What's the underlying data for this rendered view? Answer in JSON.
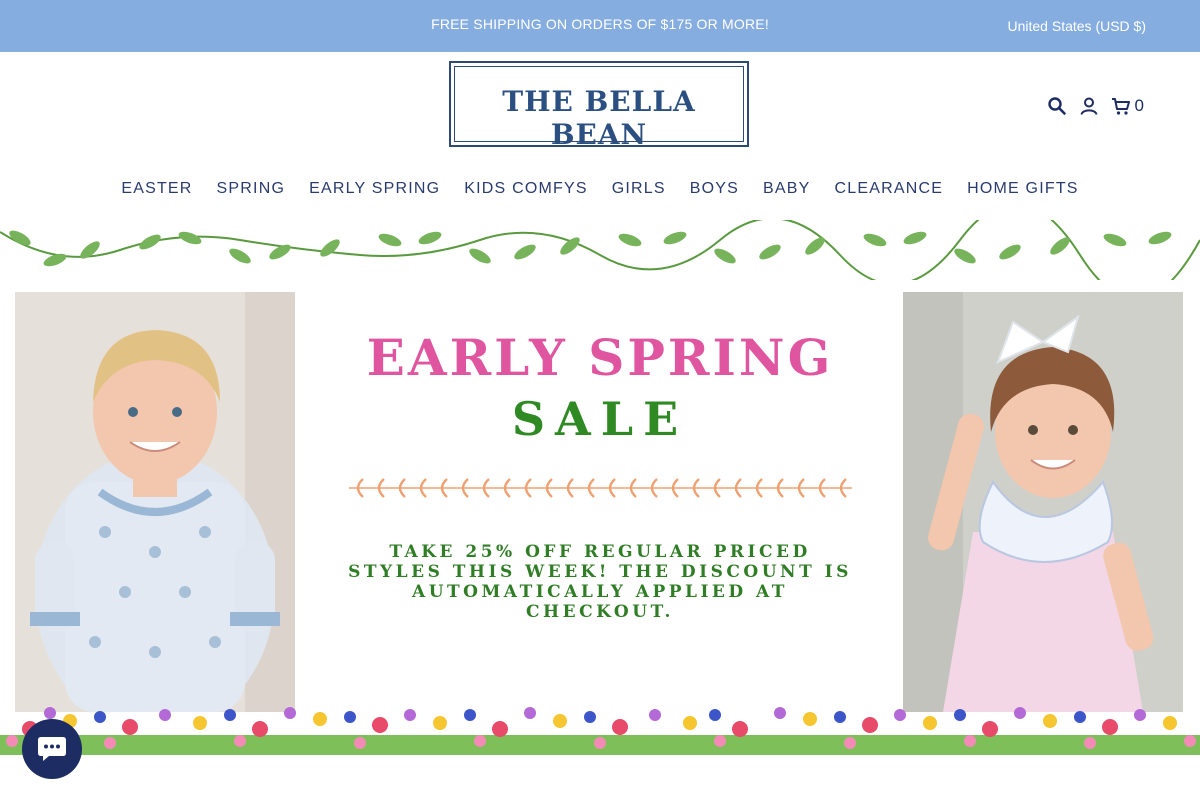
{
  "announcement": {
    "message": "FREE SHIPPING ON ORDERS OF $175 OR MORE!",
    "currency": "United States (USD $)"
  },
  "header": {
    "logo_text": "THE BELLA BEAN",
    "cart_count": "0",
    "icons": [
      "search-icon",
      "account-icon",
      "cart-icon"
    ]
  },
  "nav": {
    "items": [
      "EASTER",
      "SPRING",
      "EARLY SPRING",
      "KIDS COMFYS",
      "GIRLS",
      "BOYS",
      "BABY",
      "CLEARANCE",
      "HOME GIFTS"
    ]
  },
  "banner": {
    "headline": "EARLY SPRING",
    "subheadline": "SALE",
    "promo_lines": [
      "TAKE 25% OFF REGULAR PRICED",
      "STYLES THIS WEEK! THE DISCOUNT IS",
      "AUTOMATICALLY APPLIED AT",
      "CHECKOUT."
    ],
    "colors": {
      "headline": "#e0559f",
      "sale": "#2f8a24",
      "leaf": "#f0a070",
      "vine": "#6aa84f"
    }
  },
  "colors": {
    "announcement_bg": "#86ade0",
    "nav_text": "#2a3b6e",
    "chat_bg": "#1d2c63"
  },
  "chat": {
    "icon": "chat-icon"
  }
}
